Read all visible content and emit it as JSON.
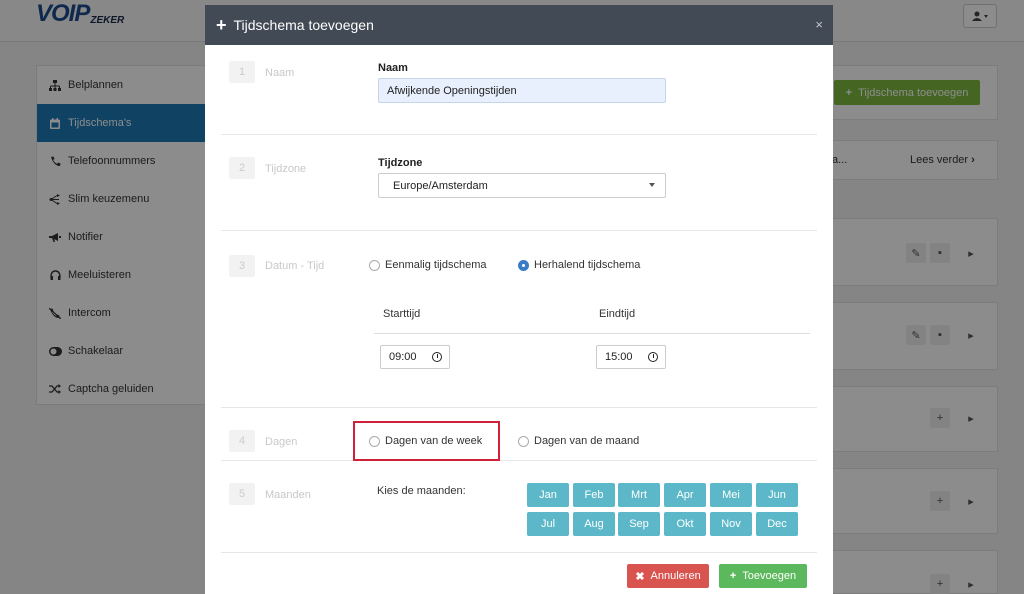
{
  "app": {
    "logo_main": "VOIP",
    "logo_sub": "ZEKER"
  },
  "sidebar": {
    "items": [
      {
        "label": "Belplannen",
        "icon": "sitemap-icon"
      },
      {
        "label": "Tijdschema's",
        "icon": "calendar-icon",
        "active": true
      },
      {
        "label": "Telefoonnummers",
        "icon": "phone-icon"
      },
      {
        "label": "Slim keuzemenu",
        "icon": "branch-icon"
      },
      {
        "label": "Notifier",
        "icon": "bullhorn-icon"
      },
      {
        "label": "Meeluisteren",
        "icon": "headphones-icon"
      },
      {
        "label": "Intercom",
        "icon": "phone-slash-icon"
      },
      {
        "label": "Schakelaar",
        "icon": "toggle-icon"
      },
      {
        "label": "Captcha geluiden",
        "icon": "shuffle-icon"
      }
    ]
  },
  "background": {
    "add_button": "Tijdschema toevoegen",
    "lees_verder": "Lees verder",
    "ellipsis": "a..."
  },
  "modal": {
    "title": "Tijdschema toevoegen",
    "close": "×",
    "steps": {
      "naam": {
        "num": "1",
        "label": "Naam",
        "field_label": "Naam",
        "value": "Afwijkende Openingstijden"
      },
      "tijdzone": {
        "num": "2",
        "label": "Tijdzone",
        "field_label": "Tijdzone",
        "value": "Europe/Amsterdam"
      },
      "datum": {
        "num": "3",
        "label": "Datum - Tijd",
        "option_once": "Eenmalig tijdschema",
        "option_repeat": "Herhalend tijdschema",
        "start_label": "Starttijd",
        "end_label": "Eindtijd",
        "start_value": "09:00",
        "end_value": "15:00"
      },
      "dagen": {
        "num": "4",
        "label": "Dagen",
        "option_week": "Dagen van de week",
        "option_month": "Dagen van de maand"
      },
      "maanden": {
        "num": "5",
        "label": "Maanden",
        "prompt": "Kies de maanden:",
        "months": [
          "Jan",
          "Feb",
          "Mrt",
          "Apr",
          "Mei",
          "Jun",
          "Jul",
          "Aug",
          "Sep",
          "Okt",
          "Nov",
          "Dec"
        ]
      }
    },
    "cancel_label": "Annuleren",
    "submit_label": "Toevoegen"
  },
  "colors": {
    "header": "#414a55",
    "active_nav": "#1e78b4",
    "month_button": "#5cb8c9",
    "cancel": "#d9534f",
    "submit": "#5cb85c",
    "highlight": "#d0213a"
  }
}
